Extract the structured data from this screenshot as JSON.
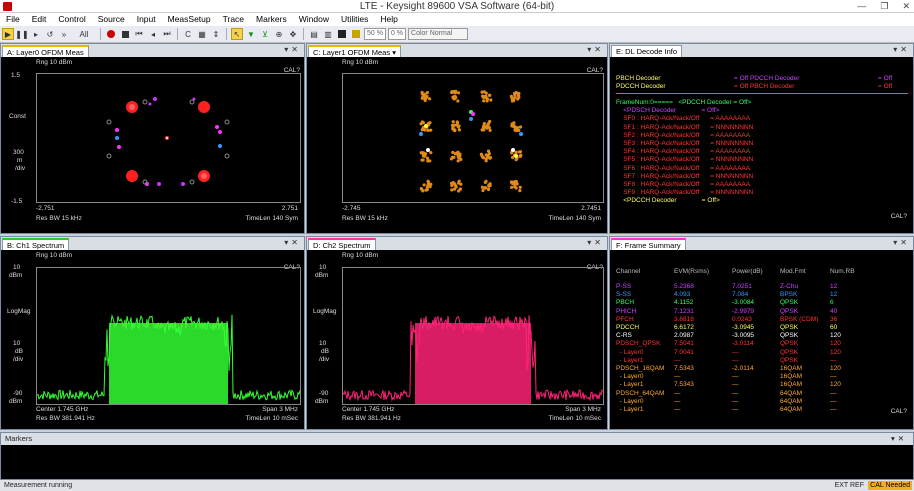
{
  "window": {
    "title": "LTE - Keysight 89600 VSA Software (64-bit)",
    "minimize": "—",
    "restore": "❐",
    "close": "✕"
  },
  "menu": [
    "File",
    "Edit",
    "Control",
    "Source",
    "Input",
    "MeasSetup",
    "Trace",
    "Markers",
    "Window",
    "Utilities",
    "Help"
  ],
  "toolbar": {
    "all_label": "All",
    "pct1": "50 %",
    "pct2": "0 %",
    "color_mode": "Color Normal"
  },
  "panels": {
    "a": {
      "tab": "A: Layer0 OFDM Meas",
      "rng": "Rng 10 dBm",
      "cal": "CAL?",
      "y_top": "1.5",
      "y_mid_label": "Const",
      "y_scale": [
        "300",
        "m",
        "/div"
      ],
      "y_bot": "-1.5",
      "x_left": "-2.751",
      "x_right": "2.751",
      "res_bw": "Res BW 15 kHz",
      "timelen": "TimeLen 140  Sym"
    },
    "c": {
      "tab": "C: Layer1 OFDM Meas",
      "rng": "Rng 10 dBm",
      "cal": "CAL?",
      "x_left": "-2.745",
      "x_right": "2.7451",
      "res_bw": "Res BW 15 kHz",
      "timelen": "TimeLen 140  Sym"
    },
    "e": {
      "tab": "E: DL Decode Info",
      "cal": "CAL?"
    },
    "b": {
      "tab": "B: Ch1 Spectrum",
      "rng": "Rng 10 dBm",
      "cal": "CAL?",
      "y_top": [
        "10",
        "dBm"
      ],
      "y_mid": "LogMag",
      "y_scale": [
        "10",
        "dB",
        "/div"
      ],
      "y_bot": [
        "-90",
        "dBm"
      ],
      "center": "Center 1.745 GHz",
      "span": "Span 3 MHz",
      "res_bw": "Res BW 381.941  Hz",
      "timelen": "TimeLen 10 mSec"
    },
    "d": {
      "tab": "D: Ch2 Spectrum",
      "rng": "Rng 10 dBm",
      "cal": "CAL?",
      "y_top": [
        "10",
        "dBm"
      ],
      "y_mid": "LogMag",
      "y_scale": [
        "10",
        "dB",
        "/div"
      ],
      "y_bot": [
        "-90",
        "dBm"
      ],
      "center": "Center 1.745 GHz",
      "span": "Span 3 MHz",
      "res_bw": "Res BW 381.941  Hz",
      "timelen": "TimeLen 10 mSec"
    },
    "f": {
      "tab": "F: Frame Summary",
      "cal": "CAL?"
    }
  },
  "decode_info": {
    "header_left": [
      {
        "text": "PBCH Decoder",
        "c": "#ffff66"
      },
      {
        "text": "PDCCH Decoder",
        "c": "#ffff66"
      }
    ],
    "header_right": [
      {
        "text": "= Off  PDCCH Decoder",
        "c": "#cc44ff"
      },
      {
        "text": "= Off  PBCH Decoder",
        "c": "#ff3333"
      }
    ],
    "header_state": [
      {
        "text": "= Off",
        "c": "#cc44ff"
      },
      {
        "text": "= Off",
        "c": "#ff3333"
      }
    ],
    "lines": [
      {
        "t": "FrameNum:0=====   <PDCCH Decoder = Off>",
        "c": "#33ff66"
      },
      {
        "t": "    <PDSCH Decoder              = Off>",
        "c": "#cc44ff"
      },
      {
        "t": "    SF0 : HARQ-Ack/Nack/Off      = AAAAAAAA",
        "c": "#ff3333"
      },
      {
        "t": "    SF1 : HARQ-Ack/Nack/Off      = NNNNNNNN",
        "c": "#ff3333"
      },
      {
        "t": "    SF2 : HARQ-Ack/Nack/Off      = AAAAAAAA",
        "c": "#ff3333"
      },
      {
        "t": "    SF3 : HARQ-Ack/Nack/Off      = NNNNNNNN",
        "c": "#ff3333"
      },
      {
        "t": "    SF4 : HARQ-Ack/Nack/Off      = AAAAAAAA",
        "c": "#ff3333"
      },
      {
        "t": "    SF5 : HARQ-Ack/Nack/Off      = NNNNNNNN",
        "c": "#ff3333"
      },
      {
        "t": "    SF6 : HARQ-Ack/Nack/Off      = AAAAAAAA",
        "c": "#ff3333"
      },
      {
        "t": "    SF7 : HARQ-Ack/Nack/Off      = NNNNNNNN",
        "c": "#ff3333"
      },
      {
        "t": "    SF8 : HARQ-Ack/Nack/Off      = AAAAAAAA",
        "c": "#ff3333"
      },
      {
        "t": "    SF9 : HARQ-Ack/Nack/Off      = NNNNNNNN",
        "c": "#ff3333"
      },
      {
        "t": "    <PDCCH Decoder              = Off>",
        "c": "#ffff66"
      }
    ]
  },
  "frame_summary": {
    "columns": [
      "Channel",
      "EVM(Rsms)",
      "Power(dB)",
      "Mod.Fmt",
      "Num.RB"
    ],
    "rows": [
      {
        "c": "#cc44ff",
        "v": [
          "P-SS",
          "5.2368",
          "7.0251",
          "Z-Chu",
          "12"
        ]
      },
      {
        "c": "#3399ff",
        "v": [
          "S-SS",
          "4.093",
          "7.084",
          "BPSK",
          "12"
        ]
      },
      {
        "c": "#33ff66",
        "v": [
          "PBCH",
          "4.1152",
          "-3.0084",
          "QPSK",
          "6"
        ]
      },
      {
        "c": "#cc44ff",
        "v": [
          "PHICH",
          "7.1231",
          "-2.9979",
          "QPSK",
          "40"
        ]
      },
      {
        "c": "#ff3333",
        "v": [
          "PFCH",
          "3.6818",
          "0.0243",
          "BPSK (CDM)",
          "36"
        ]
      },
      {
        "c": "#ffff66",
        "v": [
          "PDCCH",
          "6.6172",
          "-3.0945",
          "QPSK",
          "60"
        ]
      },
      {
        "c": "#ffffff",
        "v": [
          "C-RS",
          "2.0987",
          "-3.0095",
          "QPSK",
          "120"
        ]
      },
      {
        "c": "#ff3333",
        "v": [
          "PDSCH_QPSK",
          "7.5041",
          "-3.0114",
          "QPSK",
          "120"
        ]
      },
      {
        "c": "#ff3333",
        "v": [
          "  - Layer0",
          "7.0041",
          "—",
          "QPSK",
          "120"
        ]
      },
      {
        "c": "#ff3333",
        "v": [
          "  - Layer1",
          "—",
          "—",
          "QPSK",
          "—"
        ]
      },
      {
        "c": "#ffaa33",
        "v": [
          "PDSCH_16QAM",
          "7.5343",
          "-2.0114",
          "16QAM",
          "120"
        ]
      },
      {
        "c": "#ffaa33",
        "v": [
          "  - Layer0",
          "—",
          "—",
          "16QAM",
          "—"
        ]
      },
      {
        "c": "#ffaa33",
        "v": [
          "  - Layer1",
          "7.5343",
          "—",
          "16QAM",
          "120"
        ]
      },
      {
        "c": "#ffaa33",
        "v": [
          "PDSCH_64QAM",
          "—",
          "—",
          "64QAM",
          "—"
        ]
      },
      {
        "c": "#ffaa33",
        "v": [
          "  - Layer0",
          "—",
          "—",
          "64QAM",
          "—"
        ]
      },
      {
        "c": "#ffaa33",
        "v": [
          "  - Layer1",
          "—",
          "—",
          "64QAM",
          "—"
        ]
      }
    ]
  },
  "markers": {
    "title": "Markers"
  },
  "status": {
    "left": "Measurement running",
    "ext_ref": "EXT REF",
    "cal": "CAL Needed"
  }
}
